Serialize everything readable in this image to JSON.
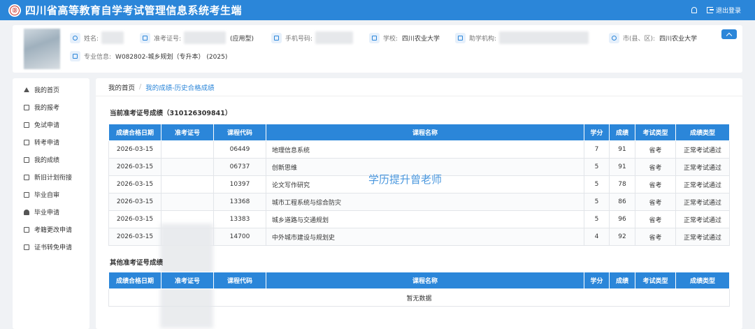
{
  "header": {
    "logo_text": "Ⓓ",
    "title": "四川省高等教育自学考试管理信息系统考生端",
    "logout_label": "退出登录"
  },
  "profile": {
    "name_label": "姓名:",
    "exam_no_label": "准考证号:",
    "exam_type": "(应用型)",
    "phone_label": "手机号码:",
    "school_label": "学校:",
    "school_value": "四川农业大学",
    "assist_label": "助学机构:",
    "city_label": "市(县、区):",
    "city_value": "四川农业大学",
    "major_label": "专业信息:",
    "major_value": "W082802-城乡规划（专升本） (2025)"
  },
  "sidebar": {
    "items": [
      {
        "label": "我的首页",
        "icon": "home-icon"
      },
      {
        "label": "我的报考",
        "icon": "book-icon"
      },
      {
        "label": "免试申请",
        "icon": "document-icon"
      },
      {
        "label": "转考申请",
        "icon": "transfer-icon"
      },
      {
        "label": "我的成绩",
        "icon": "score-icon"
      },
      {
        "label": "新旧计划衔接",
        "icon": "link-icon"
      },
      {
        "label": "毕业自审",
        "icon": "clipboard-icon"
      },
      {
        "label": "毕业申请",
        "icon": "user-icon"
      },
      {
        "label": "考籍更改申请",
        "icon": "edit-icon"
      },
      {
        "label": "证书转免申请",
        "icon": "certificate-icon"
      }
    ]
  },
  "breadcrumb": {
    "home": "我的首页",
    "separator": "/",
    "current": "我的成绩-历史合格成绩"
  },
  "current_section": {
    "title": "当前准考证号成绩（310126309841）"
  },
  "table": {
    "headers": [
      "成绩合格日期",
      "准考证号",
      "课程代码",
      "课程名称",
      "学分",
      "成绩",
      "考试类型",
      "成绩类型"
    ],
    "rows": [
      {
        "date": "2026-03-15",
        "code": "06449",
        "name": "地理信息系统",
        "credit": "7",
        "score": "91",
        "exam_type": "省考",
        "score_type": "正常考试通过"
      },
      {
        "date": "2026-03-15",
        "code": "06737",
        "name": "创新思维",
        "credit": "5",
        "score": "91",
        "exam_type": "省考",
        "score_type": "正常考试通过"
      },
      {
        "date": "2026-03-15",
        "code": "10397",
        "name": "论文写作研究",
        "credit": "5",
        "score": "78",
        "exam_type": "省考",
        "score_type": "正常考试通过"
      },
      {
        "date": "2026-03-15",
        "code": "13368",
        "name": "城市工程系统与综合防灾",
        "credit": "5",
        "score": "86",
        "exam_type": "省考",
        "score_type": "正常考试通过"
      },
      {
        "date": "2026-03-15",
        "code": "13383",
        "name": "城乡道路与交通规划",
        "credit": "5",
        "score": "96",
        "exam_type": "省考",
        "score_type": "正常考试通过"
      },
      {
        "date": "2026-03-15",
        "code": "14700",
        "name": "中外城市建设与规划史",
        "credit": "4",
        "score": "92",
        "exam_type": "省考",
        "score_type": "正常考试通过"
      }
    ]
  },
  "other_section": {
    "title": "其他准考证号成绩",
    "empty_text": "暂无数据"
  },
  "watermark": "学历提升曾老师",
  "colors": {
    "primary": "#2b86d9",
    "background": "#f0f2f5"
  }
}
